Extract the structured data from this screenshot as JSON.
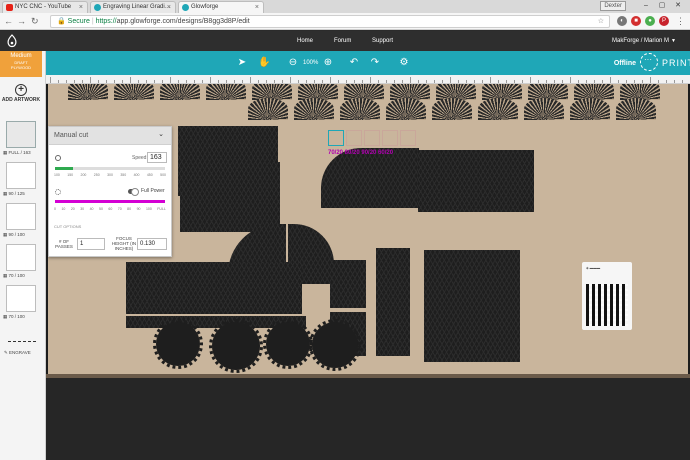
{
  "browser": {
    "tabs": [
      {
        "title": "NYC CNC - YouTube",
        "favicon_color": "#e62117",
        "active": false
      },
      {
        "title": "Engraving Linear Gradi…",
        "favicon_color": "#1fa7b7",
        "active": false
      },
      {
        "title": "Glowforge",
        "favicon_color": "#1fa7b7",
        "active": true
      }
    ],
    "window_label": "Dexter",
    "security_label": "Secure",
    "url_scheme": "https://",
    "url_rest": "app.glowforge.com/designs/B8gg3d8P/edit"
  },
  "app_nav": {
    "home": "Home",
    "forum": "Forum",
    "support": "Support",
    "user": "MakForge / Marion M"
  },
  "toolbar": {
    "zoom": "100%",
    "status": "Offline",
    "print_label": "PRINT",
    "accent_color": "#1fa7b7"
  },
  "sidebar": {
    "material": {
      "line1": "Medium",
      "line2": "DRAFT",
      "line3": "PLYWOOD"
    },
    "add_artwork": "ADD ARTWORK",
    "layers": [
      {
        "label": "FULL / 163",
        "icon": "fill-icon"
      },
      {
        "label": "90 / 125",
        "icon": "fill-icon"
      },
      {
        "label": "90 / 100",
        "icon": "fill-icon"
      },
      {
        "label": "70 / 100",
        "icon": "fill-icon"
      },
      {
        "label": "70 / 100",
        "icon": "fill-icon"
      }
    ],
    "engrave_label": "ENGRAVE"
  },
  "manual_cut": {
    "title": "Manual cut",
    "speed_label": "Speed:",
    "speed_value": "163",
    "speed_ticks": [
      "100",
      "150",
      "200",
      "250",
      "300",
      "350",
      "400",
      "450",
      "500"
    ],
    "speed_fraction": 0.16,
    "power_label": "Full Power",
    "power_ticks": [
      "0",
      "10",
      "20",
      "30",
      "40",
      "50",
      "60",
      "70",
      "80",
      "90",
      "100",
      "FULL"
    ],
    "power_fraction": 1.0,
    "cut_options_label": "CUT OPTIONS",
    "passes_label": "# OF PASSES",
    "passes_value": "1",
    "focus_label": "FOCUS HEIGHT (IN INCHES)",
    "focus_value": "0.130"
  },
  "canvas": {
    "test_labels": "70/20   80/20   90/20   60/20"
  }
}
